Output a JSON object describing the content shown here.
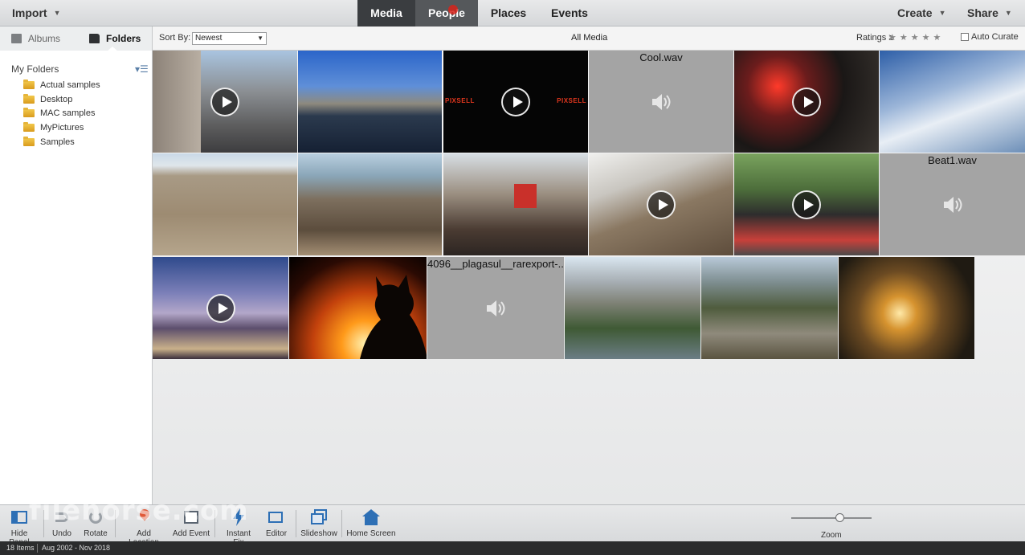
{
  "topbar": {
    "import_label": "Import",
    "create_label": "Create",
    "share_label": "Share",
    "tabs": [
      {
        "label": "Media"
      },
      {
        "label": "People"
      },
      {
        "label": "Places"
      },
      {
        "label": "Events"
      }
    ]
  },
  "subbar": {
    "albums_label": "Albums",
    "folders_label": "Folders",
    "sort_by_label": "Sort By:",
    "sort_value": "Newest",
    "view_title": "All Media",
    "ratings_label": "Ratings",
    "ratings_symbol": "≥",
    "stars": "★★★★★",
    "auto_curate_label": "Auto Curate"
  },
  "sidebar": {
    "title": "My Folders",
    "folders": [
      {
        "label": "Actual samples"
      },
      {
        "label": "Desktop"
      },
      {
        "label": "MAC samples"
      },
      {
        "label": "MyPictures"
      },
      {
        "label": "Samples"
      }
    ]
  },
  "media": {
    "audio": [
      {
        "name": "Cool.wav"
      },
      {
        "name": "Beat1.wav"
      },
      {
        "name": "4096__plagasul__rarexport-..."
      }
    ],
    "pixsell_text": "PIXSELL"
  },
  "toolbar": {
    "hide_panel": "Hide Panel",
    "undo": "Undo",
    "rotate": "Rotate",
    "add_location": "Add Location",
    "add_event": "Add Event",
    "instant_fix": "Instant Fix",
    "editor": "Editor",
    "slideshow": "Slideshow",
    "home_screen": "Home Screen",
    "zoom": "Zoom"
  },
  "status": {
    "items": "18 Items",
    "date_range": "Aug 2002 - Nov 2018"
  },
  "watermark": "filehorse.com"
}
